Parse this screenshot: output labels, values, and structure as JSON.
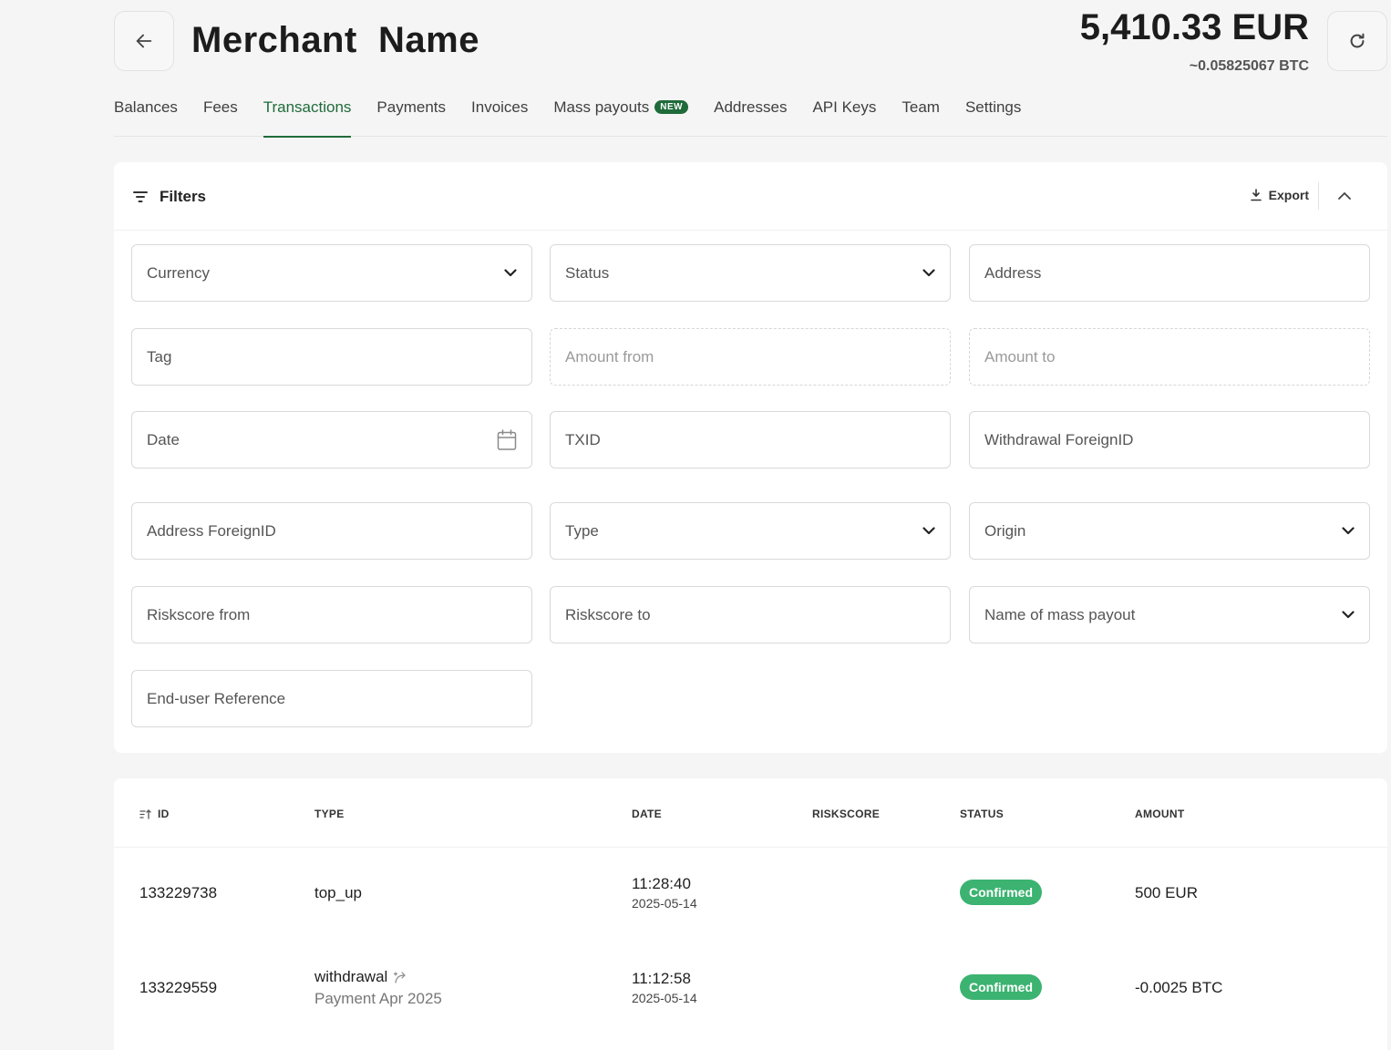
{
  "header": {
    "title": "Merchant  Name",
    "balance_main": "5,410.33 EUR",
    "balance_sub": "~0.05825067 BTC",
    "back_icon": "arrow-left-icon",
    "refresh_icon": "refresh-icon"
  },
  "tabs": [
    {
      "label": "Balances"
    },
    {
      "label": "Fees"
    },
    {
      "label": "Transactions",
      "active": true
    },
    {
      "label": "Payments"
    },
    {
      "label": "Invoices"
    },
    {
      "label": "Mass payouts",
      "badge": "NEW"
    },
    {
      "label": "Addresses"
    },
    {
      "label": "API Keys"
    },
    {
      "label": "Team"
    },
    {
      "label": "Settings"
    }
  ],
  "filters": {
    "title": "Filters",
    "export_label": "Export",
    "fields": {
      "currency": "Currency",
      "status": "Status",
      "address": "Address",
      "tag": "Tag",
      "amount_from": "Amount from",
      "amount_to": "Amount to",
      "date": "Date",
      "txid": "TXID",
      "withdrawal_foreign_id": "Withdrawal ForeignID",
      "address_foreign_id": "Address ForeignID",
      "type": "Type",
      "origin": "Origin",
      "riskscore_from": "Riskscore from",
      "riskscore_to": "Riskscore to",
      "mass_payout_name": "Name of mass payout",
      "end_user_reference": "End-user Reference"
    }
  },
  "table": {
    "columns": {
      "id": "ID",
      "type": "TYPE",
      "date": "DATE",
      "riskscore": "RISKSCORE",
      "status": "STATUS",
      "amount": "AMOUNT"
    },
    "rows": [
      {
        "id": "133229738",
        "type": "top_up",
        "type_note": "",
        "time": "11:28:40",
        "date": "2025-05-14",
        "riskscore": "",
        "status": "Confirmed",
        "amount": "500 EUR"
      },
      {
        "id": "133229559",
        "type": "withdrawal",
        "type_note": "Payment Apr 2025",
        "time": "11:12:58",
        "date": "2025-05-14",
        "riskscore": "",
        "status": "Confirmed",
        "amount": "-0.0025 BTC"
      }
    ]
  },
  "colors": {
    "accent": "#1f6b3a",
    "status_confirmed": "#3cb371",
    "background": "#f5f5f5"
  }
}
